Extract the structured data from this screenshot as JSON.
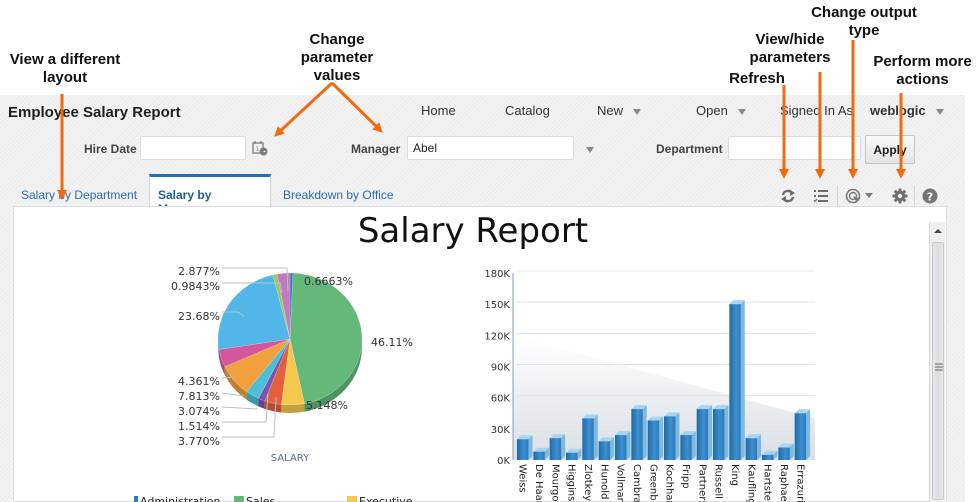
{
  "annotations": {
    "view_layout": "View a different layout",
    "view_layout_l1": "View a different",
    "view_layout_l2": "layout",
    "change_params_l1": "Change",
    "change_params_l2": "parameter",
    "change_params_l3": "values",
    "refresh": "Refresh",
    "view_hide_l1": "View/hide",
    "view_hide_l2": "parameters",
    "output_l1": "Change output",
    "output_l2": "type",
    "more_l1": "Perform more",
    "more_l2": "actions",
    "arrow_color": "#f26a0f"
  },
  "header": {
    "title": "Employee Salary Report",
    "nav": {
      "home": "Home",
      "catalog": "Catalog",
      "new": "New",
      "open": "Open",
      "signed_in_as": "Signed In As",
      "user": "weblogic"
    }
  },
  "parameters": {
    "hire_date": {
      "label": "Hire Date",
      "value": ""
    },
    "manager": {
      "label": "Manager",
      "value": "Abel"
    },
    "department": {
      "label": "Department",
      "value": ""
    },
    "apply_label": "Apply"
  },
  "tabs": [
    {
      "label": "Salary by Department",
      "active": false
    },
    {
      "label": "Salary by Manager",
      "active": true
    },
    {
      "label": "Breakdown by Office",
      "active": false
    }
  ],
  "toolbar": {
    "icons": [
      "refresh-icon",
      "view-parameters-icon",
      "output-type-icon",
      "actions-gear-icon",
      "help-icon"
    ]
  },
  "report": {
    "title": "Salary Report"
  },
  "chart_data": [
    {
      "type": "pie",
      "title": "",
      "xlabel": "SALARY",
      "slices": [
        {
          "label": "0.6663%",
          "value": 0.6663,
          "color": "#2f7fc1"
        },
        {
          "label": "46.11%",
          "value": 46.11,
          "color": "#63b87a"
        },
        {
          "label": "5.148%",
          "value": 5.148,
          "color": "#f2c94c"
        },
        {
          "label": "3.770%",
          "value": 3.77,
          "color": "#e5603a"
        },
        {
          "label": "1.514%",
          "value": 1.514,
          "color": "#7b54b3"
        },
        {
          "label": "3.074%",
          "value": 3.074,
          "color": "#4bbfd6"
        },
        {
          "label": "7.813%",
          "value": 7.813,
          "color": "#f0a03c"
        },
        {
          "label": "4.361%",
          "value": 4.361,
          "color": "#d4579e"
        },
        {
          "label": "23.68%",
          "value": 23.68,
          "color": "#52b6e9"
        },
        {
          "label": "0.9843%",
          "value": 0.9843,
          "color": "#9cc85c"
        },
        {
          "label": "2.877%",
          "value": 2.877,
          "color": "#c07ac0"
        }
      ],
      "legend": {
        "placement": "bottom",
        "entries": [
          {
            "label": "Administration",
            "color": "#2f7fc1"
          },
          {
            "label": "Sales",
            "color": "#63b87a"
          },
          {
            "label": "Executive",
            "color": "#f2c94c"
          }
        ]
      }
    },
    {
      "type": "bar",
      "title": "",
      "xlabel": "",
      "ylabel": "",
      "ylim": [
        0,
        180000
      ],
      "yticks": [
        "0K",
        "30K",
        "60K",
        "90K",
        "120K",
        "150K",
        "180K"
      ],
      "grid": true,
      "categories": [
        "Weiss",
        "De Haan",
        "Mourgos",
        "Higgins",
        "Zlotkey",
        "Hunold",
        "Vollman",
        "Cambrault",
        "Greenberg",
        "Kochhar",
        "Fripp",
        "Partners",
        "Russell",
        "King",
        "Kaufling",
        "Hartstein",
        "Raphaely",
        "Errazuriz"
      ],
      "tick_labels": [
        "Weiss",
        "De Haar",
        "Mourgo:",
        "Higgins",
        "Zlotkey",
        "Hunold",
        "Vollman",
        "Cambra",
        "Greenb",
        "Kochhar",
        "Fripp",
        "Partner:",
        "Russell",
        "King",
        "Kaufling",
        "Hartstei",
        "Raphae",
        "Errazuri"
      ],
      "values": [
        20000,
        8000,
        21000,
        7000,
        40000,
        18000,
        24000,
        49000,
        38000,
        42000,
        24000,
        49000,
        49000,
        150000,
        21000,
        5000,
        12000,
        45000
      ],
      "bar_color": "#2f7cc0"
    }
  ]
}
